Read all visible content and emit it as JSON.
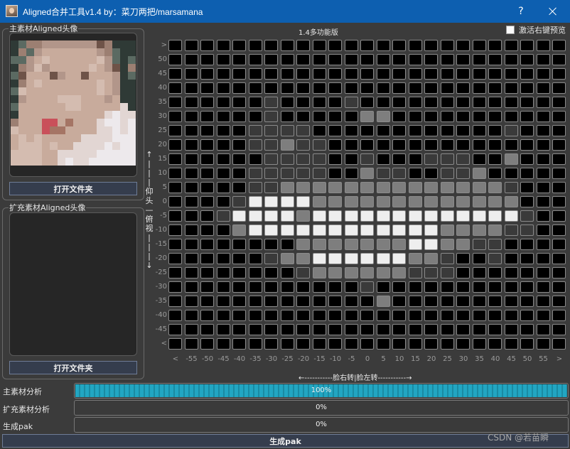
{
  "window": {
    "title": "Aligned合并工具v1.4  by：菜刀两把/marsamana",
    "help": "?"
  },
  "left": {
    "main_group_title": "主素材Aligned头像",
    "main_open_button": "打开文件夹",
    "ext_group_title": "扩充素材Aligned头像",
    "ext_open_button": "打开文件夹"
  },
  "top": {
    "version": "1.4多功能版",
    "right_click_preview_label": "激活右键预览",
    "right_click_preview_checked": false
  },
  "grid": {
    "y_labels": [
      ">",
      "50",
      "45",
      "40",
      "35",
      "30",
      "25",
      "20",
      "15",
      "10",
      "5",
      "0",
      "-5",
      "-10",
      "-15",
      "-20",
      "-25",
      "-30",
      "-35",
      "-40",
      "-45",
      "<"
    ],
    "x_labels": [
      "<",
      "-55",
      "-50",
      "-45",
      "-40",
      "-35",
      "-30",
      "-25",
      "-20",
      "-15",
      "-10",
      "-5",
      "0",
      "5",
      "10",
      "15",
      "20",
      "25",
      "30",
      "35",
      "40",
      "45",
      "50",
      "55",
      ">"
    ],
    "cells": [
      "0000000000000000000000000",
      "0000000000000000000000000",
      "0000000000000000000000000",
      "0000000000000000000000000",
      "0000001000010000000000000",
      "0000001000002200000000000",
      "0000011110000000000001000",
      "0000011211000000000000000",
      "0000001111001000111002000",
      "0000011111002110011200000",
      "0000011222222222222221000",
      "0000133332222222222222000",
      "0001333323333333333333100",
      "0000233333333333322221100",
      "0000000022222223322110000",
      "0000001223333332210010000",
      "0000000012222221110000000",
      "0000000000001000000000000",
      "0000000000000200000000000",
      "0000000000000000000000000",
      "0000000000000000000000000",
      "0000000000000000000000000"
    ],
    "level_colors": [
      "#000000",
      "#3a3a3a",
      "#7e7e7e",
      "#eeeeee"
    ],
    "x_axis_label": "←-----------脸右转|脸左转-----------→",
    "y_axis_label": "←——仰头——俯视——→"
  },
  "progress": [
    {
      "label": "主素材分析",
      "value": 1.0,
      "text": "100%"
    },
    {
      "label": "扩充素材分析",
      "value": 0.0,
      "text": "0%"
    },
    {
      "label": "生成pak",
      "value": 0.0,
      "text": "0%"
    }
  ],
  "generate_button": "生成pak",
  "watermark": "CSDN @若苗瞬"
}
